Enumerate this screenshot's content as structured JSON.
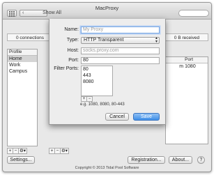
{
  "window": {
    "title": "MacProxy",
    "show_all": "Show All"
  },
  "status": {
    "connections": "0 connections",
    "received": "0 B received"
  },
  "profiles": {
    "header": "Profile",
    "items": [
      "Home",
      "Work",
      "Campus"
    ]
  },
  "proxy_table": {
    "headers": [
      "",
      "Port"
    ],
    "rows": [
      [
        "m",
        "1080"
      ]
    ]
  },
  "list_controls": {
    "add": "+",
    "remove": "−",
    "gear": "⚙▾"
  },
  "buttons": {
    "settings": "Settings...",
    "registration": "Registration...",
    "about": "About...",
    "help": "?"
  },
  "copyright": "Copyright © 2013 Tidal Pool Software",
  "sheet": {
    "name_label": "Name:",
    "name_placeholder": "My Proxy",
    "type_label": "Type:",
    "type_value": "HTTP Transparent",
    "host_label": "Host:",
    "host_placeholder": "socks.proxy.com",
    "port_label": "Port:",
    "port_value": "80",
    "filter_label": "Filter Ports:",
    "filter_ports": [
      "80",
      "443",
      "8080"
    ],
    "hint": "e.g. 1080, 8080, 80-443",
    "cancel": "Cancel",
    "save": "Save"
  },
  "colors": {
    "accent": "#3f8fe8",
    "selection": "#d4d4d4"
  }
}
